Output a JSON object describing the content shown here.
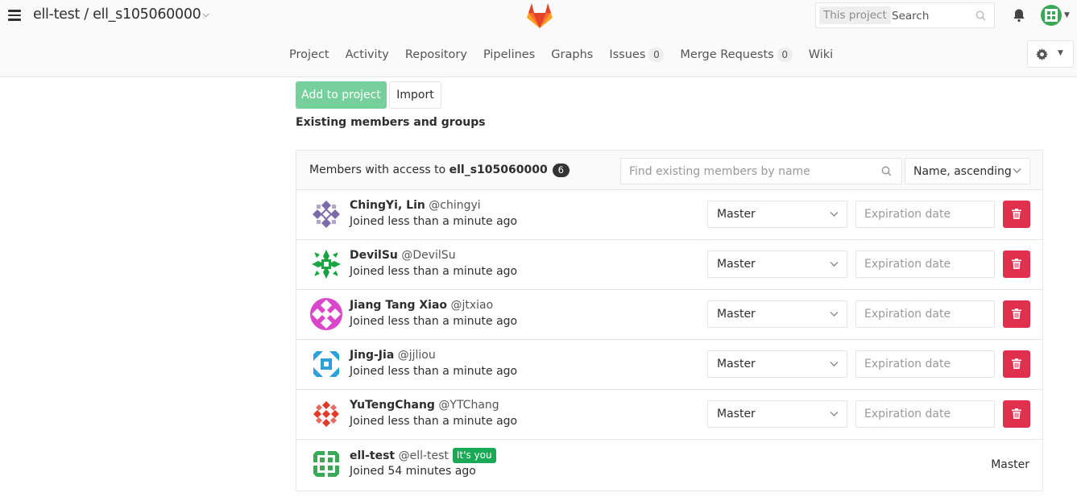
{
  "header": {
    "breadcrumb": "ell-test / ell_s105060000",
    "search_scope": "This project",
    "search_placeholder": "Search"
  },
  "nav": {
    "items": [
      {
        "label": "Project"
      },
      {
        "label": "Activity"
      },
      {
        "label": "Repository"
      },
      {
        "label": "Pipelines"
      },
      {
        "label": "Graphs"
      },
      {
        "label": "Issues",
        "count": "0"
      },
      {
        "label": "Merge Requests",
        "count": "0"
      },
      {
        "label": "Wiki"
      }
    ]
  },
  "actions": {
    "add_label": "Add to project",
    "import_label": "Import"
  },
  "members": {
    "section_title": "Existing members and groups",
    "access_prefix": "Members with access to",
    "project_name": "ell_s105060000",
    "count": "6",
    "filter_placeholder": "Find existing members by name",
    "sort_label": "Name, ascending",
    "list": [
      {
        "name": "ChingYi, Lin",
        "username": "@chingyi",
        "joined": "Joined less than a minute ago",
        "role": "Master",
        "expiration_placeholder": "Expiration date",
        "avatar_color": "#7b6ba8"
      },
      {
        "name": "DevilSu",
        "username": "@DevilSu",
        "joined": "Joined less than a minute ago",
        "role": "Master",
        "expiration_placeholder": "Expiration date",
        "avatar_color": "#1aa544"
      },
      {
        "name": "Jiang Tang Xiao",
        "username": "@jtxiao",
        "joined": "Joined less than a minute ago",
        "role": "Master",
        "expiration_placeholder": "Expiration date",
        "avatar_color": "#d946c9"
      },
      {
        "name": "Jing-Jia",
        "username": "@jjliou",
        "joined": "Joined less than a minute ago",
        "role": "Master",
        "expiration_placeholder": "Expiration date",
        "avatar_color": "#2d9fd9"
      },
      {
        "name": "YuTengChang",
        "username": "@YTChang",
        "joined": "Joined less than a minute ago",
        "role": "Master",
        "expiration_placeholder": "Expiration date",
        "avatar_color": "#e03a2a"
      },
      {
        "name": "ell-test",
        "username": "@ell-test",
        "badge": "It's you",
        "joined": "Joined 54 minutes ago",
        "role": "Master",
        "avatar_color": "#3aa856"
      }
    ]
  },
  "colors": {
    "accent_green": "#75d09b",
    "danger": "#e0304e",
    "badge_green": "#1aaa55"
  }
}
